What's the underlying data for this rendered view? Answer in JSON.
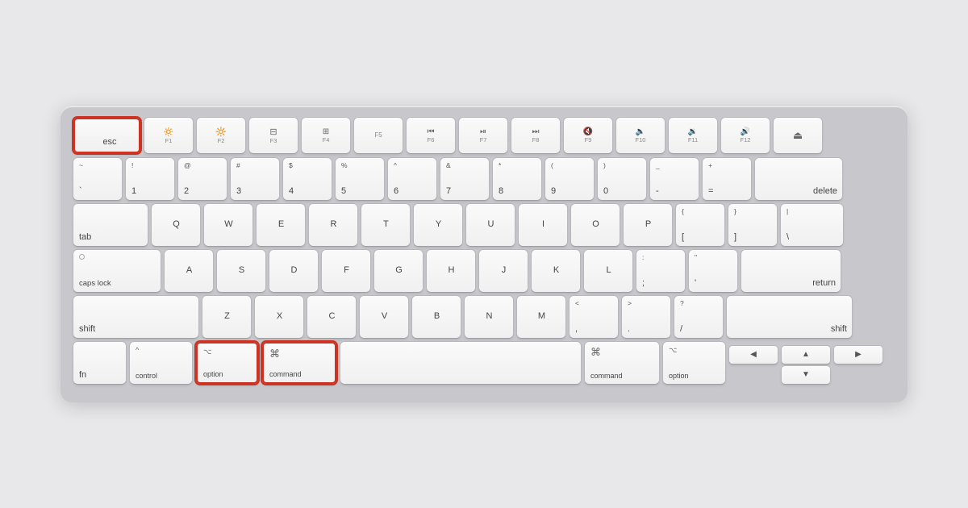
{
  "keyboard": {
    "background_color": "#c8c8cc",
    "highlighted_keys": [
      "esc",
      "option-left",
      "command-left"
    ],
    "rows": {
      "fn_row": {
        "keys": [
          {
            "id": "esc",
            "label": "esc",
            "highlighted": true
          },
          {
            "id": "f1",
            "icon": "☀",
            "label": "F1"
          },
          {
            "id": "f2",
            "icon": "✦",
            "label": "F2"
          },
          {
            "id": "f3",
            "icon": "⊡",
            "label": "F3"
          },
          {
            "id": "f4",
            "icon": "⊞",
            "label": "F4"
          },
          {
            "id": "f5",
            "label": "F5"
          },
          {
            "id": "f6",
            "icon": "◁◁",
            "label": "F6"
          },
          {
            "id": "f7",
            "icon": "▷❙",
            "label": "F7"
          },
          {
            "id": "f8",
            "icon": "▷▷",
            "label": "F8"
          },
          {
            "id": "f9",
            "icon": "◁",
            "label": "F9"
          },
          {
            "id": "f10",
            "icon": "◁)",
            "label": "F10"
          },
          {
            "id": "f11",
            "icon": "◁))",
            "label": "F11"
          },
          {
            "id": "f12",
            "icon": "◁)))",
            "label": "F12"
          },
          {
            "id": "eject",
            "icon": "⏏",
            "label": ""
          }
        ]
      },
      "row1": {
        "keys": [
          {
            "id": "backtick",
            "top": "~",
            "main": "`"
          },
          {
            "id": "1",
            "top": "!",
            "main": "1"
          },
          {
            "id": "2",
            "top": "@",
            "main": "2"
          },
          {
            "id": "3",
            "top": "#",
            "main": "3"
          },
          {
            "id": "4",
            "top": "$",
            "main": "4"
          },
          {
            "id": "5",
            "top": "%",
            "main": "5"
          },
          {
            "id": "6",
            "top": "^",
            "main": "6"
          },
          {
            "id": "7",
            "top": "&",
            "main": "7"
          },
          {
            "id": "8",
            "top": "*",
            "main": "8"
          },
          {
            "id": "9",
            "top": "(",
            "main": "9"
          },
          {
            "id": "0",
            "top": ")",
            "main": "0"
          },
          {
            "id": "minus",
            "top": "_",
            "main": "-"
          },
          {
            "id": "equals",
            "top": "+",
            "main": "="
          },
          {
            "id": "delete",
            "main": "delete",
            "wide": true
          }
        ]
      }
    }
  }
}
